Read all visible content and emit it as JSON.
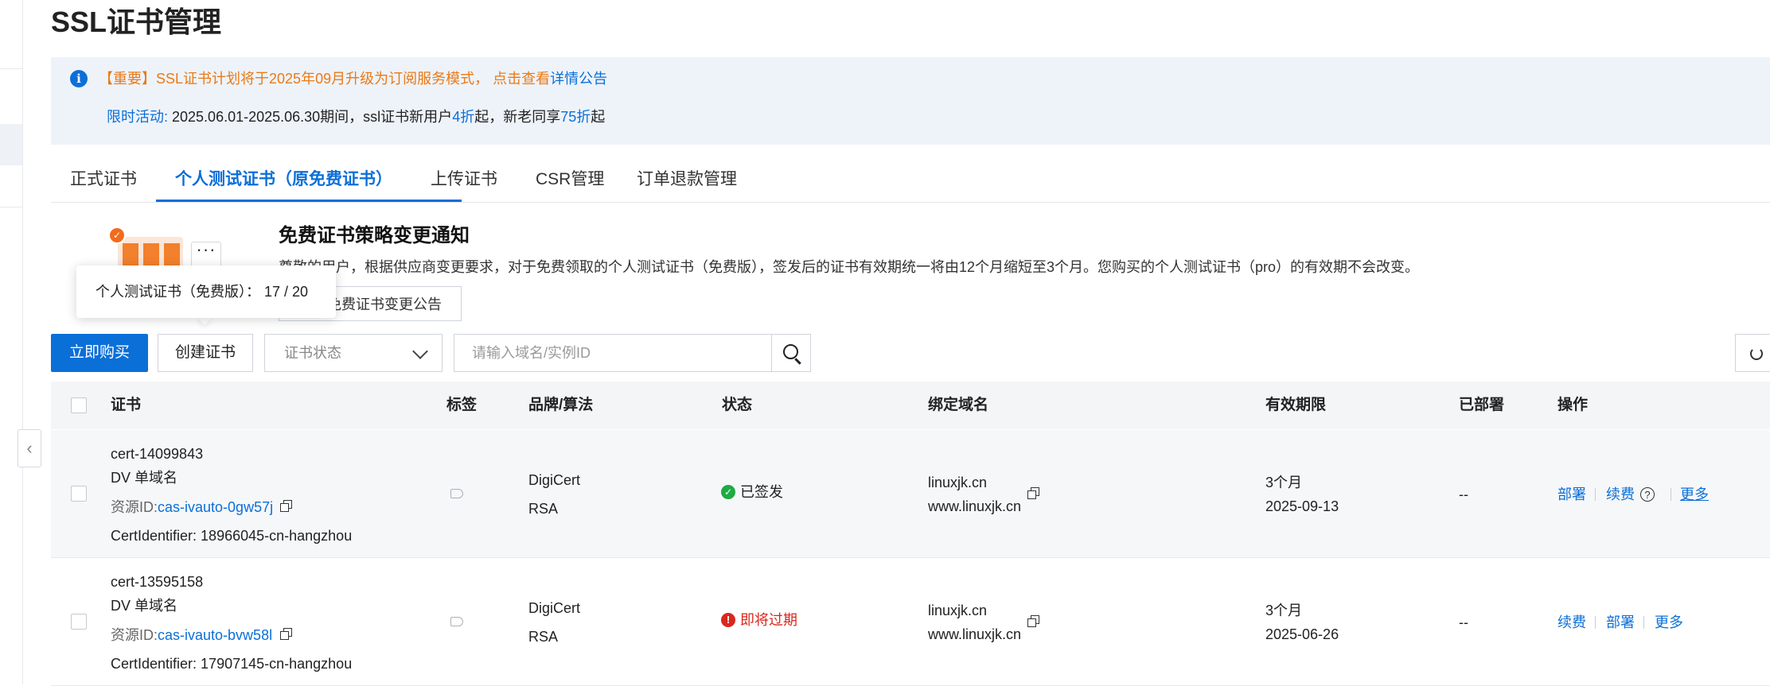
{
  "page_title": "SSL证书管理",
  "notice": {
    "line1_text": "【重要】SSL证书计划将于2025年09月升级为订阅服务模式， 点击查看",
    "line1_link": "详情公告",
    "line2_label": "限时活动:",
    "line2_text_a": " 2025.06.01-2025.06.30期间，ssl证书新用户",
    "line2_hl1": "4折",
    "line2_text_b": "起，新老同享",
    "line2_hl2": "75折",
    "line2_text_c": "起"
  },
  "tabs": [
    {
      "label": "正式证书"
    },
    {
      "label": "个人测试证书（原免费证书）"
    },
    {
      "label": "上传证书"
    },
    {
      "label": "CSR管理"
    },
    {
      "label": "订单退款管理"
    }
  ],
  "banner": {
    "title": "免费证书策略变更通知",
    "text": "尊敬的用户，根据供应商变更要求，对于免费领取的个人测试证书（免费版），签发后的证书有效期统一将由12个月缩短至3个月。您购买的个人测试证书（pro）的有效期不会改变。",
    "button_label": "免费证书变更公告"
  },
  "tooltip": "个人测试证书（免费版）： 17 / 20",
  "toolbar": {
    "buy_label": "立即购买",
    "create_label": "创建证书",
    "status_placeholder": "证书状态",
    "search_placeholder": "请输入域名/实例ID"
  },
  "table": {
    "headers": {
      "cert": "证书",
      "tags": "标签",
      "brand": "品牌/算法",
      "status": "状态",
      "domain": "绑定域名",
      "validity": "有效期限",
      "deployed": "已部署",
      "actions": "操作"
    },
    "rows": [
      {
        "cert_id": "cert-14099843",
        "type": "DV 单域名",
        "resource_label": "资源ID:",
        "resource_id": "cas-ivauto-0gw57j",
        "identifier": "CertIdentifier: 18966045-cn-hangzhou",
        "brand": "DigiCert",
        "algo": "RSA",
        "status": "已签发",
        "status_color": "#1faa44",
        "domain1": "linuxjk.cn",
        "domain2": "www.linuxjk.cn",
        "validity": "3个月",
        "expiry": "2025-09-13",
        "deployed": "--",
        "action1": "部署",
        "action2": "续费",
        "action3": "更多"
      },
      {
        "cert_id": "cert-13595158",
        "type": "DV 单域名",
        "resource_label": "资源ID:",
        "resource_id": "cas-ivauto-bvw58l",
        "identifier": "CertIdentifier: 17907145-cn-hangzhou",
        "brand": "DigiCert",
        "algo": "RSA",
        "status": "即将过期",
        "status_color": "#d9281d",
        "domain1": "linuxjk.cn",
        "domain2": "www.linuxjk.cn",
        "validity": "3个月",
        "expiry": "2025-06-26",
        "deployed": "--",
        "action1": "续费",
        "action2": "部署",
        "action3": "更多"
      }
    ]
  }
}
